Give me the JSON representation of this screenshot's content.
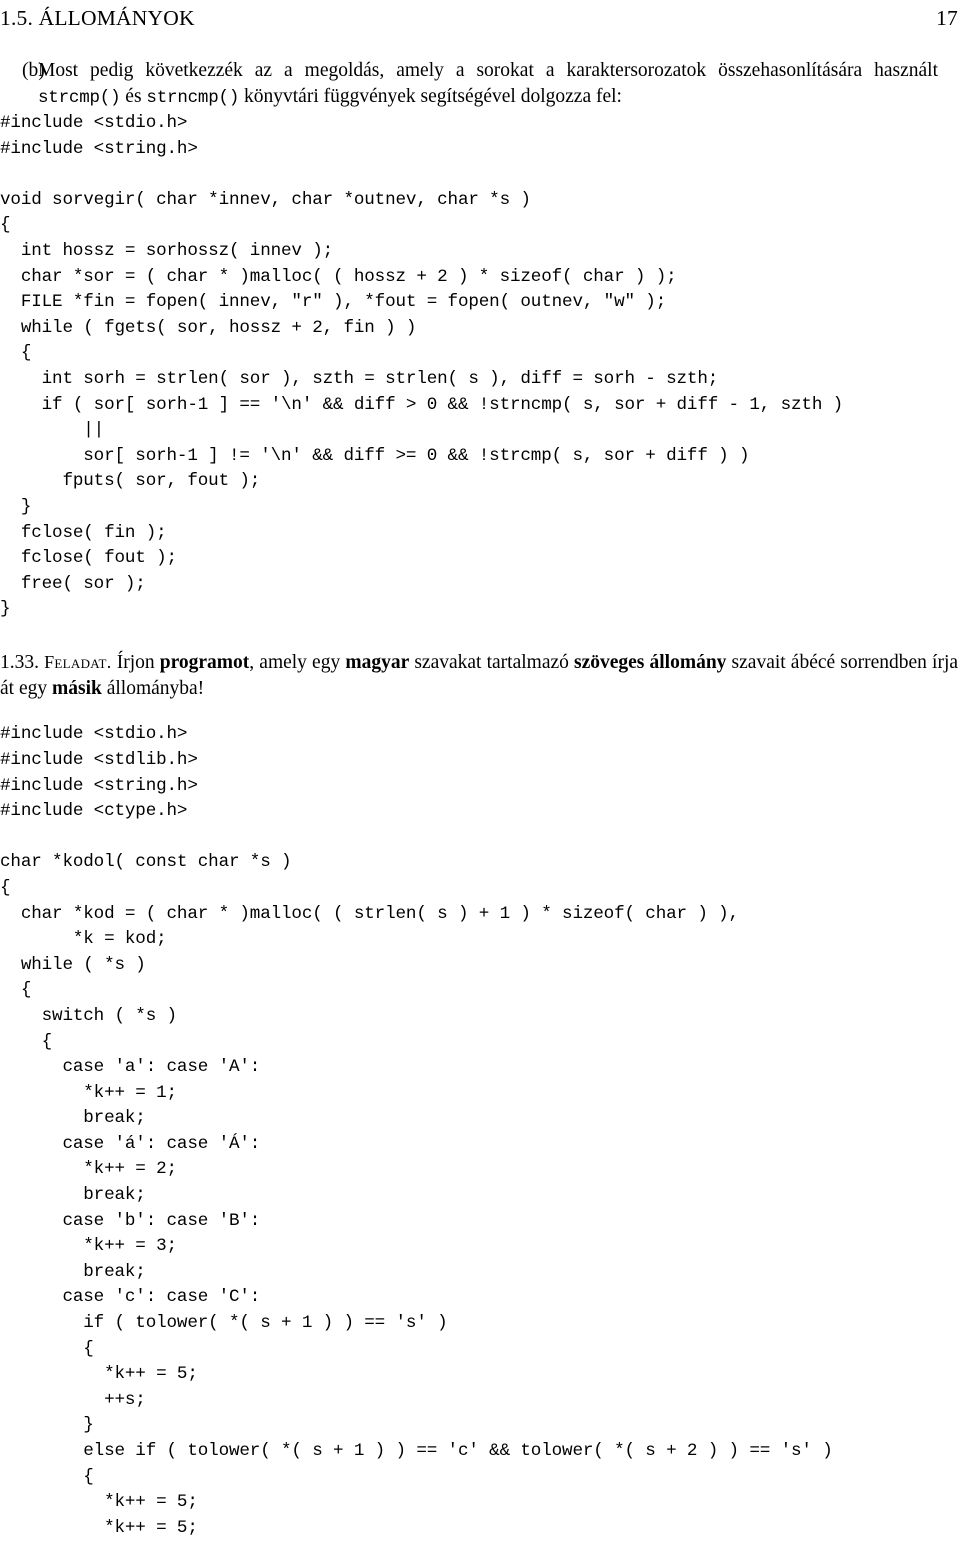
{
  "page": {
    "running_head_title": "1.5. ÁLLOMÁNYOK",
    "page_number": "17"
  },
  "item_b": {
    "label": "(b)",
    "text_part1": "Most pedig következzék az a megoldás, amely a sorokat a karaktersorozatok összehasonlítására használt ",
    "mono1": "strcmp()",
    "text_part2": " és ",
    "mono2": "strncmp()",
    "text_part3": " könyvtári függvények segítségével dolgozza fel:"
  },
  "code_listing_1": "#include <stdio.h>\n#include <string.h>\n\nvoid sorvegir( char *innev, char *outnev, char *s )\n{\n  int hossz = sorhossz( innev );\n  char *sor = ( char * )malloc( ( hossz + 2 ) * sizeof( char ) );\n  FILE *fin = fopen( innev, \"r\" ), *fout = fopen( outnev, \"w\" );\n  while ( fgets( sor, hossz + 2, fin ) )\n  {\n    int sorh = strlen( sor ), szth = strlen( s ), diff = sorh - szth;\n    if ( sor[ sorh-1 ] == '\\n' && diff > 0 && !strncmp( s, sor + diff - 1, szth )\n        ||\n        sor[ sorh-1 ] != '\\n' && diff >= 0 && !strcmp( s, sor + diff ) )\n      fputs( sor, fout );\n  }\n  fclose( fin );\n  fclose( fout );\n  free( sor );\n}",
  "exercise_133": {
    "number": "1.33.",
    "keyword": "Feladat.",
    "seg1": "Írjon ",
    "bold1": "programot",
    "seg2": ", amely egy ",
    "bold2": "magyar",
    "seg3": " szavakat tartalmazó ",
    "bold3": "szöveges állomány",
    "seg4": " szavait ábécé sorrendben írja át egy ",
    "bold4": "másik",
    "seg5": " állományba!"
  },
  "code_listing_2": "#include <stdio.h>\n#include <stdlib.h>\n#include <string.h>\n#include <ctype.h>\n\nchar *kodol( const char *s )\n{\n  char *kod = ( char * )malloc( ( strlen( s ) + 1 ) * sizeof( char ) ),\n       *k = kod;\n  while ( *s )\n  {\n    switch ( *s )\n    {\n      case 'a': case 'A':\n        *k++ = 1;\n        break;\n      case 'á': case 'Á':\n        *k++ = 2;\n        break;\n      case 'b': case 'B':\n        *k++ = 3;\n        break;\n      case 'c': case 'C':\n        if ( tolower( *( s + 1 ) ) == 's' )\n        {\n          *k++ = 5;\n          ++s;\n        }\n        else if ( tolower( *( s + 1 ) ) == 'c' && tolower( *( s + 2 ) ) == 's' )\n        {\n          *k++ = 5;\n          *k++ = 5;"
}
